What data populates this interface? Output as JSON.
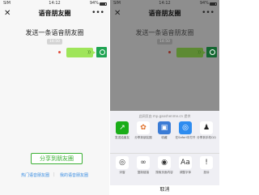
{
  "status": {
    "carrier": "SIM",
    "time": "14:12",
    "battery": "94%"
  },
  "nav": {
    "close": "✕",
    "title": "语音朋友圈",
    "more": "•••"
  },
  "content": {
    "heading": "发送一条语音朋友圈",
    "time_pill": "14:50",
    "wave": "))"
  },
  "share_button": "分享到朋友圈",
  "links": {
    "hot": "热门语音朋友圈",
    "sep": "|",
    "mine": "我的语音朋友圈"
  },
  "sheet": {
    "source": "此网页由 mp.gaoshenme.cn 提供",
    "row1": [
      {
        "label": "发送给朋友",
        "icon": "share-friend-icon",
        "glyph": "↗",
        "color": "#1aad19"
      },
      {
        "label": "分享到朋友圈",
        "icon": "moments-icon",
        "glyph": "✿",
        "color": "#ffffff"
      },
      {
        "label": "收藏",
        "icon": "favorite-icon",
        "glyph": "▣",
        "color": "#3a7bd5"
      },
      {
        "label": "在Safari中打开",
        "icon": "safari-icon",
        "glyph": "◎",
        "color": "#2d8cf0"
      },
      {
        "label": "分享到手机QQ",
        "icon": "qq-icon",
        "glyph": "♟",
        "color": "#ffffff"
      }
    ],
    "row2": [
      {
        "label": "浮窗",
        "icon": "float-window-icon",
        "glyph": "◎"
      },
      {
        "label": "复制链接",
        "icon": "link-icon",
        "glyph": "∞"
      },
      {
        "label": "搜索页面内容",
        "icon": "search-page-icon",
        "glyph": "◉"
      },
      {
        "label": "调整字体",
        "icon": "font-size-icon",
        "glyph": "Aa"
      },
      {
        "label": "投诉",
        "icon": "complain-icon",
        "glyph": "!"
      }
    ],
    "cancel": "取消"
  }
}
